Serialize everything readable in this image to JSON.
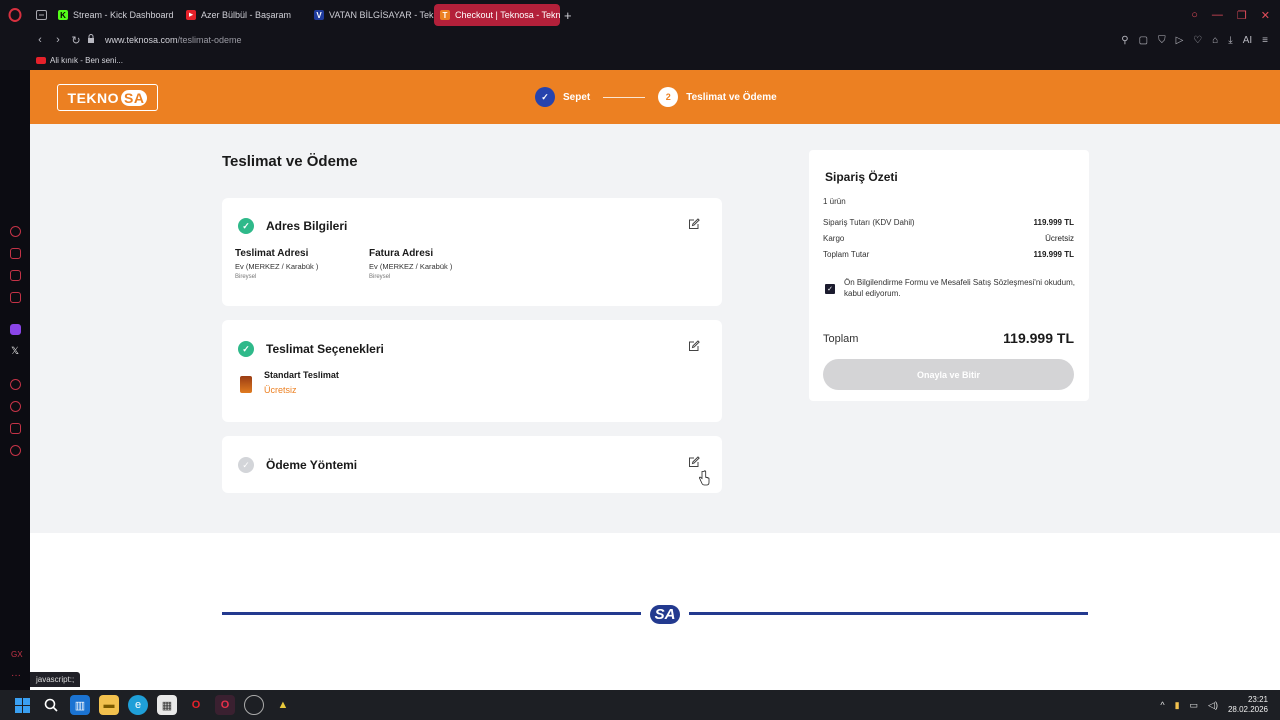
{
  "browser": {
    "tabs": [
      {
        "label": "Stream - Kick Dashboard",
        "color": "#53fc18",
        "glyph": "K"
      },
      {
        "label": "Azer Bülbül - Başaram",
        "color": "#e5212a",
        "glyph": "▶"
      },
      {
        "label": "VATAN BİLGİSAYAR - Tekn",
        "color": "#1f3b9c",
        "glyph": "V"
      },
      {
        "label": "Checkout | Teknosa - Tekn",
        "color": "#ec8022",
        "glyph": "T"
      }
    ],
    "url_host": "www.teknosa.com",
    "url_path": "/teslimat-odeme",
    "bookmark": "Ali kınık - Ben seni...",
    "status_tip": "javascript:;"
  },
  "header": {
    "logo_main": "TEKNO",
    "logo_sa": "SA",
    "step1_label": "Sepet",
    "step2_number": "2",
    "step2_label": "Teslimat ve Ödeme"
  },
  "main": {
    "title": "Teslimat ve Ödeme",
    "address": {
      "title": "Adres Bilgileri",
      "delivery_title": "Teslimat Adresi",
      "delivery_line": "Ev (MERKEZ / Karabük )",
      "delivery_type": "Bireysel",
      "invoice_title": "Fatura Adresi",
      "invoice_line": "Ev (MERKEZ / Karabük )",
      "invoice_type": "Bireysel"
    },
    "shipping": {
      "title": "Teslimat Seçenekleri",
      "option_name": "Standart Teslimat",
      "option_price": "Ücretsiz"
    },
    "payment": {
      "title": "Ödeme Yöntemi"
    }
  },
  "summary": {
    "title": "Sipariş Özeti",
    "item_count": "1 ürün",
    "rows": [
      {
        "label": "Sipariş Tutarı (KDV Dahil)",
        "value": "119.999 TL"
      },
      {
        "label": "Kargo",
        "value": "Ücretsiz"
      },
      {
        "label": "Toplam Tutar",
        "value": "119.999 TL"
      }
    ],
    "agreement": "Ön Bilgilendirme Formu ve Mesafeli Satış Sözleşmesi'ni okudum, kabul ediyorum.",
    "total_label": "Toplam",
    "total_value": "119.999 TL",
    "confirm_label": "Onayla ve Bitir"
  },
  "footer": {
    "logo": "SA"
  },
  "taskbar": {
    "time": "23:21",
    "date": "28.02.2026"
  },
  "colors": {
    "brand_orange": "#ec8022",
    "brand_blue": "#233a8f",
    "success_green": "#2fb98a"
  }
}
